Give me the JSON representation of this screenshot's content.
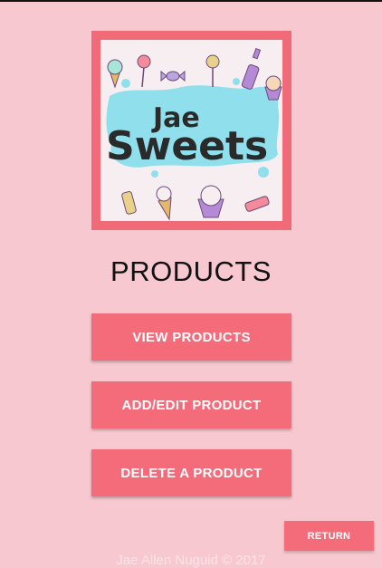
{
  "logo": {
    "line1": "Jae",
    "line2": "Sweets",
    "splash_color": "#8fe0ec",
    "frame_color": "#f06a78"
  },
  "page": {
    "title": "PRODUCTS"
  },
  "buttons": {
    "view_products": "VIEW PRODUCTS",
    "add_edit_product": "ADD/EDIT PRODUCT",
    "delete_product": "DELETE A PRODUCT",
    "return": "RETURN"
  },
  "footer": {
    "credit": "Jae Allen Nuguid © 2017"
  },
  "colors": {
    "background": "#f8c8d0",
    "button": "#f46b7a",
    "button_text": "#ffffff"
  }
}
